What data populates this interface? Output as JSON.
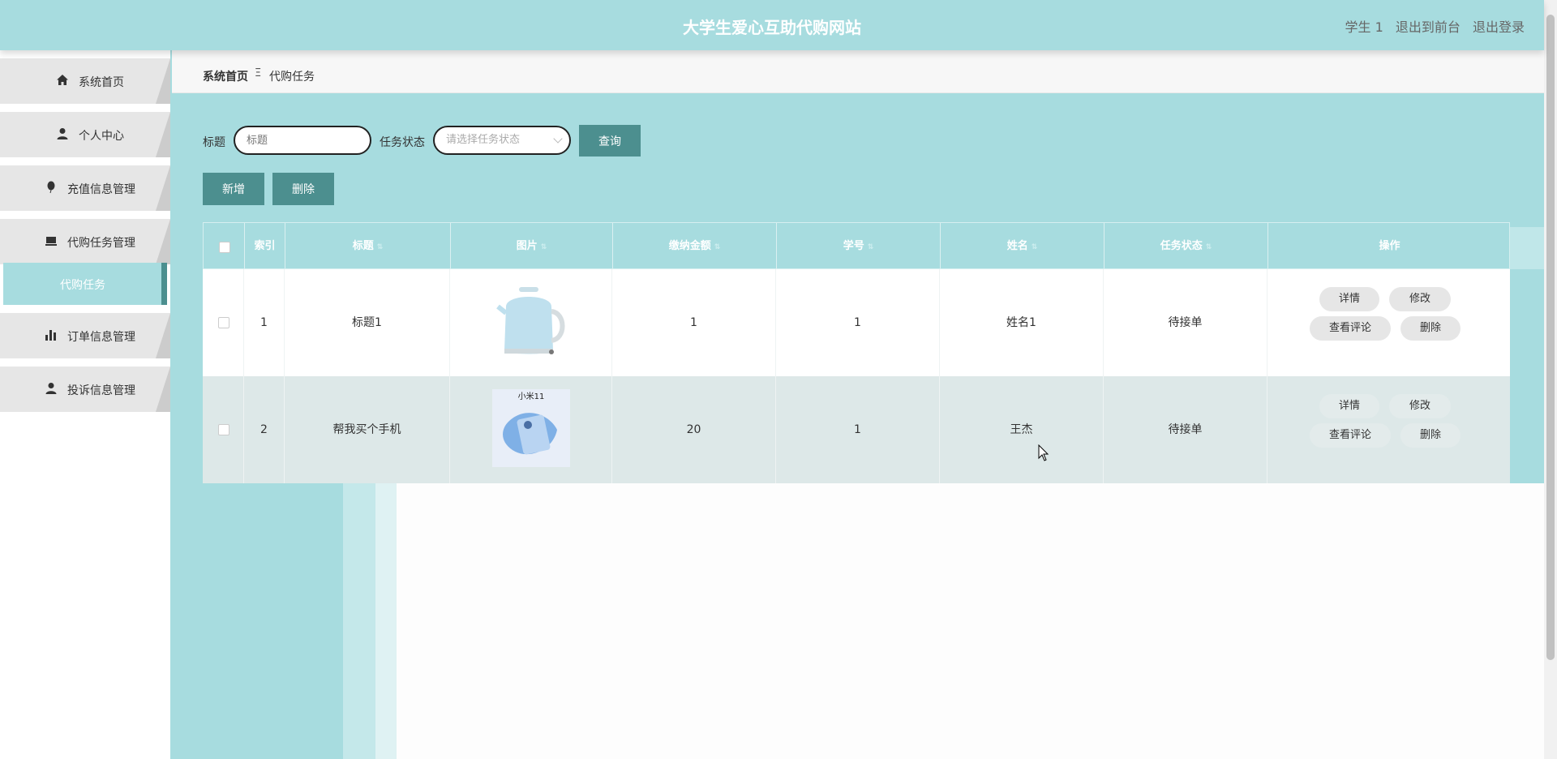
{
  "header": {
    "title": "大学生爱心互助代购网站",
    "user": "学生 1",
    "links": [
      "退出到前台",
      "退出登录"
    ]
  },
  "sidebar": {
    "items": [
      {
        "label": "系统首页",
        "icon": "home-icon"
      },
      {
        "label": "个人中心",
        "icon": "user-icon"
      },
      {
        "label": "充值信息管理",
        "icon": "balloon-icon"
      },
      {
        "label": "代购任务管理",
        "icon": "cart-icon"
      },
      {
        "label": "订单信息管理",
        "icon": "bar-chart-icon"
      },
      {
        "label": "投诉信息管理",
        "icon": "user-icon"
      }
    ],
    "submenu": "代购任务"
  },
  "breadcrumb": {
    "home": "系统首页",
    "separator": "Ξ",
    "current": "代购任务"
  },
  "search": {
    "title_label": "标题",
    "title_placeholder": "标题",
    "status_label": "任务状态",
    "status_placeholder": "请选择任务状态",
    "query_button": "查询"
  },
  "actions": {
    "add": "新增",
    "delete": "删除"
  },
  "table": {
    "columns": [
      "索引",
      "标题",
      "图片",
      "缴纳金额",
      "学号",
      "姓名",
      "任务状态",
      "操作"
    ],
    "rows": [
      {
        "index": "1",
        "title": "标题1",
        "image": "kettle-image",
        "amount": "1",
        "student_id": "1",
        "name": "姓名1",
        "status": "待接单"
      },
      {
        "index": "2",
        "title": "帮我买个手机",
        "image": "phone-box-image",
        "image_text": "小米11",
        "amount": "20",
        "student_id": "1",
        "name": "王杰",
        "status": "待接单"
      }
    ],
    "row_actions": [
      "详情",
      "修改",
      "查看评论",
      "删除"
    ]
  },
  "colors": {
    "accent": "#a7dcdf",
    "button": "#4c8f8f"
  }
}
